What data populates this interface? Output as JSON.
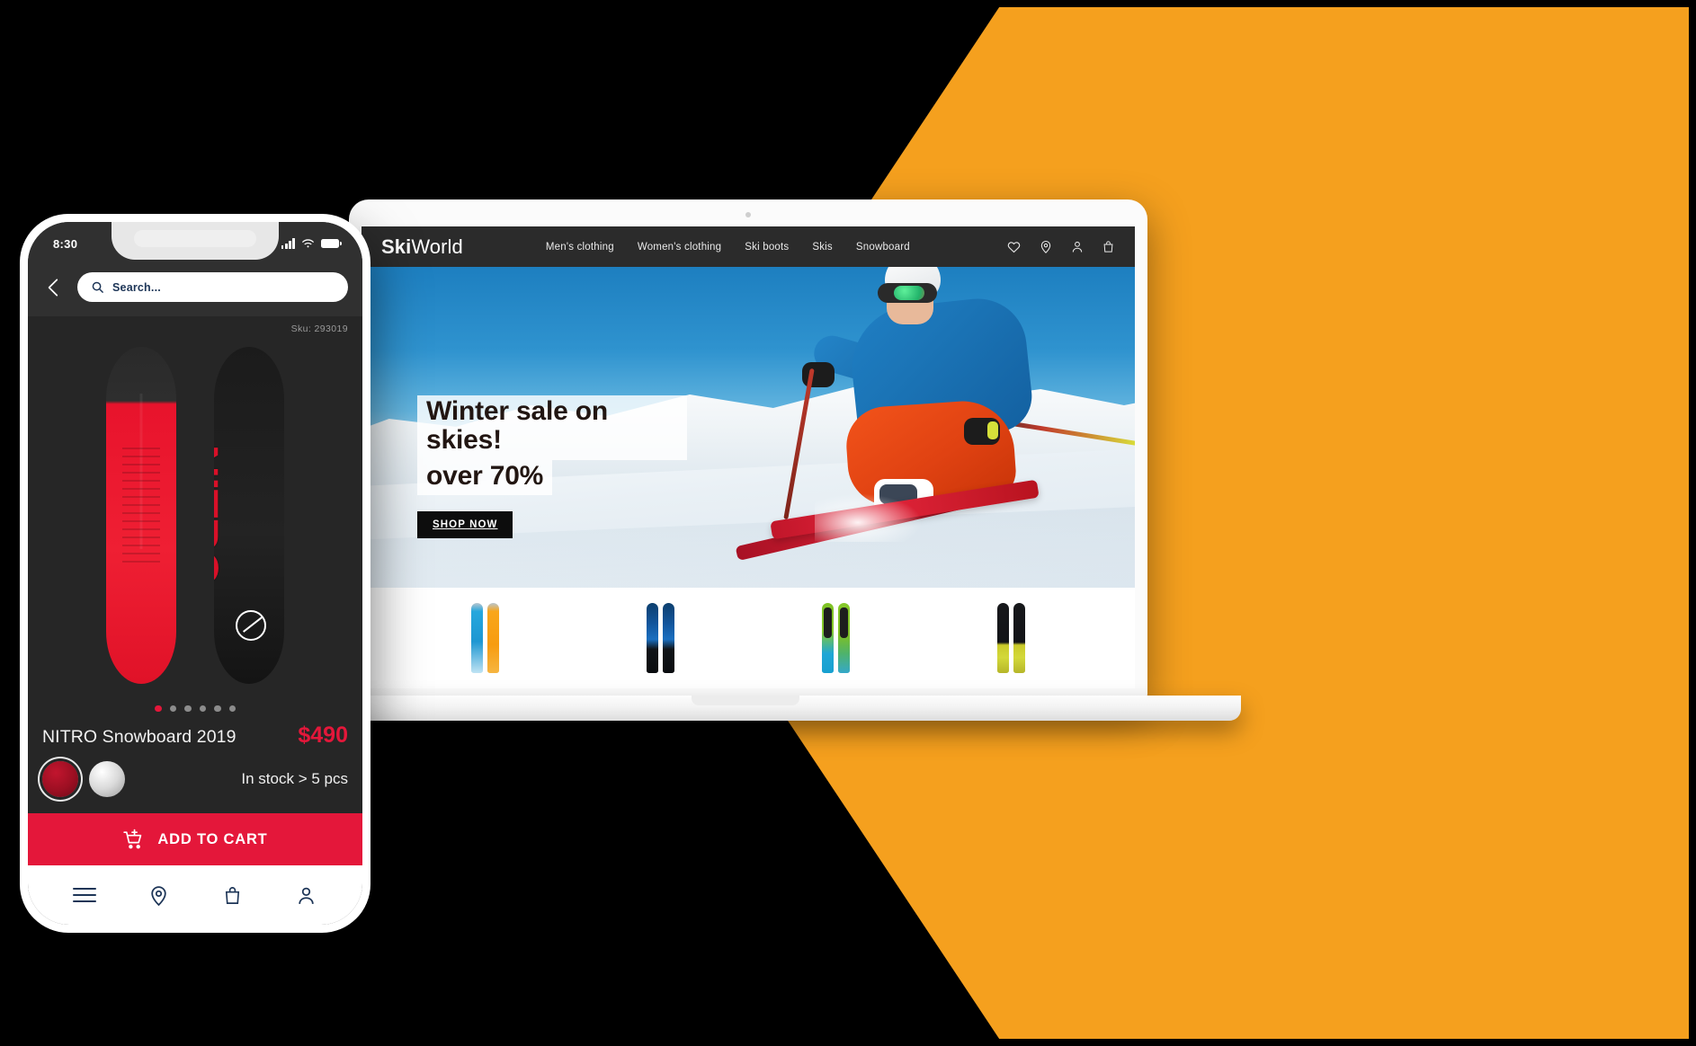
{
  "phone": {
    "status": {
      "time": "8:30",
      "signal_icon": "signal-bars-icon",
      "wifi_icon": "wifi-icon",
      "battery_icon": "battery-icon"
    },
    "back_icon": "back-chevron-icon",
    "search": {
      "icon": "search-icon",
      "placeholder": "Search...",
      "value": ""
    },
    "sku_label": "Sku: 293019",
    "product": {
      "brand_mark": "NITRO",
      "title": "NITRO Snowboard 2019",
      "price": "$490",
      "stock": "In stock > 5 pcs",
      "carousel_dots": 6,
      "carousel_active_index": 0,
      "colors": [
        {
          "name": "red",
          "hex": "#9b0f22",
          "selected": true
        },
        {
          "name": "silver",
          "hex": "#d9d9d9",
          "selected": false
        }
      ]
    },
    "cta": {
      "icon": "cart-plus-icon",
      "label": "ADD TO CART",
      "color": "#e4173a"
    },
    "bottom_nav": [
      {
        "name": "menu",
        "icon": "hamburger-menu-icon"
      },
      {
        "name": "stores",
        "icon": "location-pin-icon"
      },
      {
        "name": "bag",
        "icon": "shopping-bag-icon"
      },
      {
        "name": "account",
        "icon": "user-person-icon"
      }
    ]
  },
  "laptop": {
    "site": {
      "logo": {
        "bold": "Ski",
        "light": "World"
      },
      "nav": [
        {
          "label": "Men's clothing"
        },
        {
          "label": "Women's clothing"
        },
        {
          "label": "Ski boots"
        },
        {
          "label": "Skis"
        },
        {
          "label": "Snowboard"
        }
      ],
      "header_icons": [
        {
          "name": "wishlist",
          "icon": "heart-icon"
        },
        {
          "name": "stores",
          "icon": "location-pin-icon"
        },
        {
          "name": "account",
          "icon": "user-person-icon"
        },
        {
          "name": "cart",
          "icon": "shopping-bag-icon"
        }
      ],
      "hero": {
        "headline_line1": "Winter sale on skies!",
        "headline_line2": "over 70%",
        "cta_label": "SHOP NOW",
        "image_alt": "skier-carving-turn-photo"
      },
      "products": [
        {
          "name": "ski-pair-cyan-orange",
          "color_a": "#1e97d2",
          "color_b": "#f79c10"
        },
        {
          "name": "ski-pair-blue-black",
          "color_a": "#1a6fc0",
          "color_b": "#0a0c0f"
        },
        {
          "name": "ski-pair-green-cyan",
          "color_a": "#86c92b",
          "color_b": "#1fa7d6"
        },
        {
          "name": "ski-pair-black-yellow",
          "color_a": "#17181b",
          "color_b": "#d3d83a"
        }
      ]
    }
  },
  "theme": {
    "background": "#000000",
    "accent_orange": "#F5A01E",
    "accent_red": "#e4173a",
    "dark_ui": "#262626"
  }
}
